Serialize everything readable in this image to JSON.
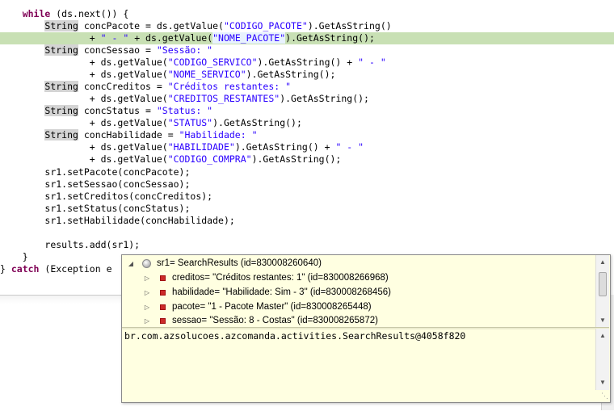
{
  "code": {
    "l1_kw": "while",
    "l1_rest": " (ds.next()) {",
    "l2_type": "String",
    "l2_a": " concPacote = ds.getValue(",
    "l2_s": "\"CODIGO_PACOTE\"",
    "l2_b": ").GetAsString()",
    "l3_a": "+ ",
    "l3_s1": "\" - \"",
    "l3_b": " + ds.getValue(",
    "l3_s2": "\"NOME_PACOTE\"",
    "l3_c": ").GetAsString();",
    "l4_type": "String",
    "l4_a": " concSessao = ",
    "l4_s": "\"Sessão: \"",
    "l5_a": "+ ds.getValue(",
    "l5_s1": "\"CODIGO_SERVICO\"",
    "l5_b": ").GetAsString() + ",
    "l5_s2": "\" - \"",
    "l6_a": "+ ds.getValue(",
    "l6_s": "\"NOME_SERVICO\"",
    "l6_b": ").GetAsString();",
    "l7_type": "String",
    "l7_a": " concCreditos = ",
    "l7_s": "\"Créditos restantes: \"",
    "l8_a": "+ ds.getValue(",
    "l8_s": "\"CREDITOS_RESTANTES\"",
    "l8_b": ").GetAsString();",
    "l9_type": "String",
    "l9_a": " concStatus = ",
    "l9_s": "\"Status: \"",
    "l10_a": "+ ds.getValue(",
    "l10_s": "\"STATUS\"",
    "l10_b": ").GetAsString();",
    "l11_type": "String",
    "l11_a": " concHabilidade = ",
    "l11_s": "\"Habilidade: \"",
    "l12_a": "+ ds.getValue(",
    "l12_s1": "\"HABILIDADE\"",
    "l12_b": ").GetAsString() + ",
    "l12_s2": "\" - \"",
    "l13_a": "+ ds.getValue(",
    "l13_s": "\"CODIGO_COMPRA\"",
    "l13_b": ").GetAsString();",
    "l14": "sr1.setPacote(concPacote);",
    "l15": "sr1.setSessao(concSessao);",
    "l16": "sr1.setCreditos(concCreditos);",
    "l17": "sr1.setStatus(concStatus);",
    "l18": "sr1.setHabilidade(concHabilidade);",
    "l19": "results.add(sr1);",
    "l20": "}",
    "l21_a": "} ",
    "l21_kw": "catch",
    "l21_b": " (Exception e"
  },
  "popup": {
    "root_label": "sr1= SearchResults  (id=830008260640)",
    "fields": [
      {
        "label": "creditos= \"Créditos restantes: 1\" (id=830008266968)"
      },
      {
        "label": "habilidade= \"Habilidade: Sim - 3\" (id=830008268456)"
      },
      {
        "label": "pacote= \"1 - Pacote Master\" (id=830008265448)"
      },
      {
        "label": "sessao= \"Sessão: 8 - Costas\" (id=830008265872)"
      }
    ],
    "detail": "br.com.azsolucoes.azcomanda.activities.SearchResults@4058f820"
  },
  "icons": {
    "root": "object-icon",
    "field": "private-field-icon",
    "expand": "expand-triangle-icon",
    "collapse": "collapse-triangle-icon",
    "scroll_up": "scroll-up-arrow-icon",
    "scroll_down": "scroll-down-arrow-icon",
    "grip": "resize-grip-icon"
  },
  "colors": {
    "keyword": "#7f0055",
    "string": "#2a00ff",
    "current_line": "#c8e0b4",
    "popup_bg": "#ffffe1",
    "field_icon": "#cc2a2a"
  }
}
